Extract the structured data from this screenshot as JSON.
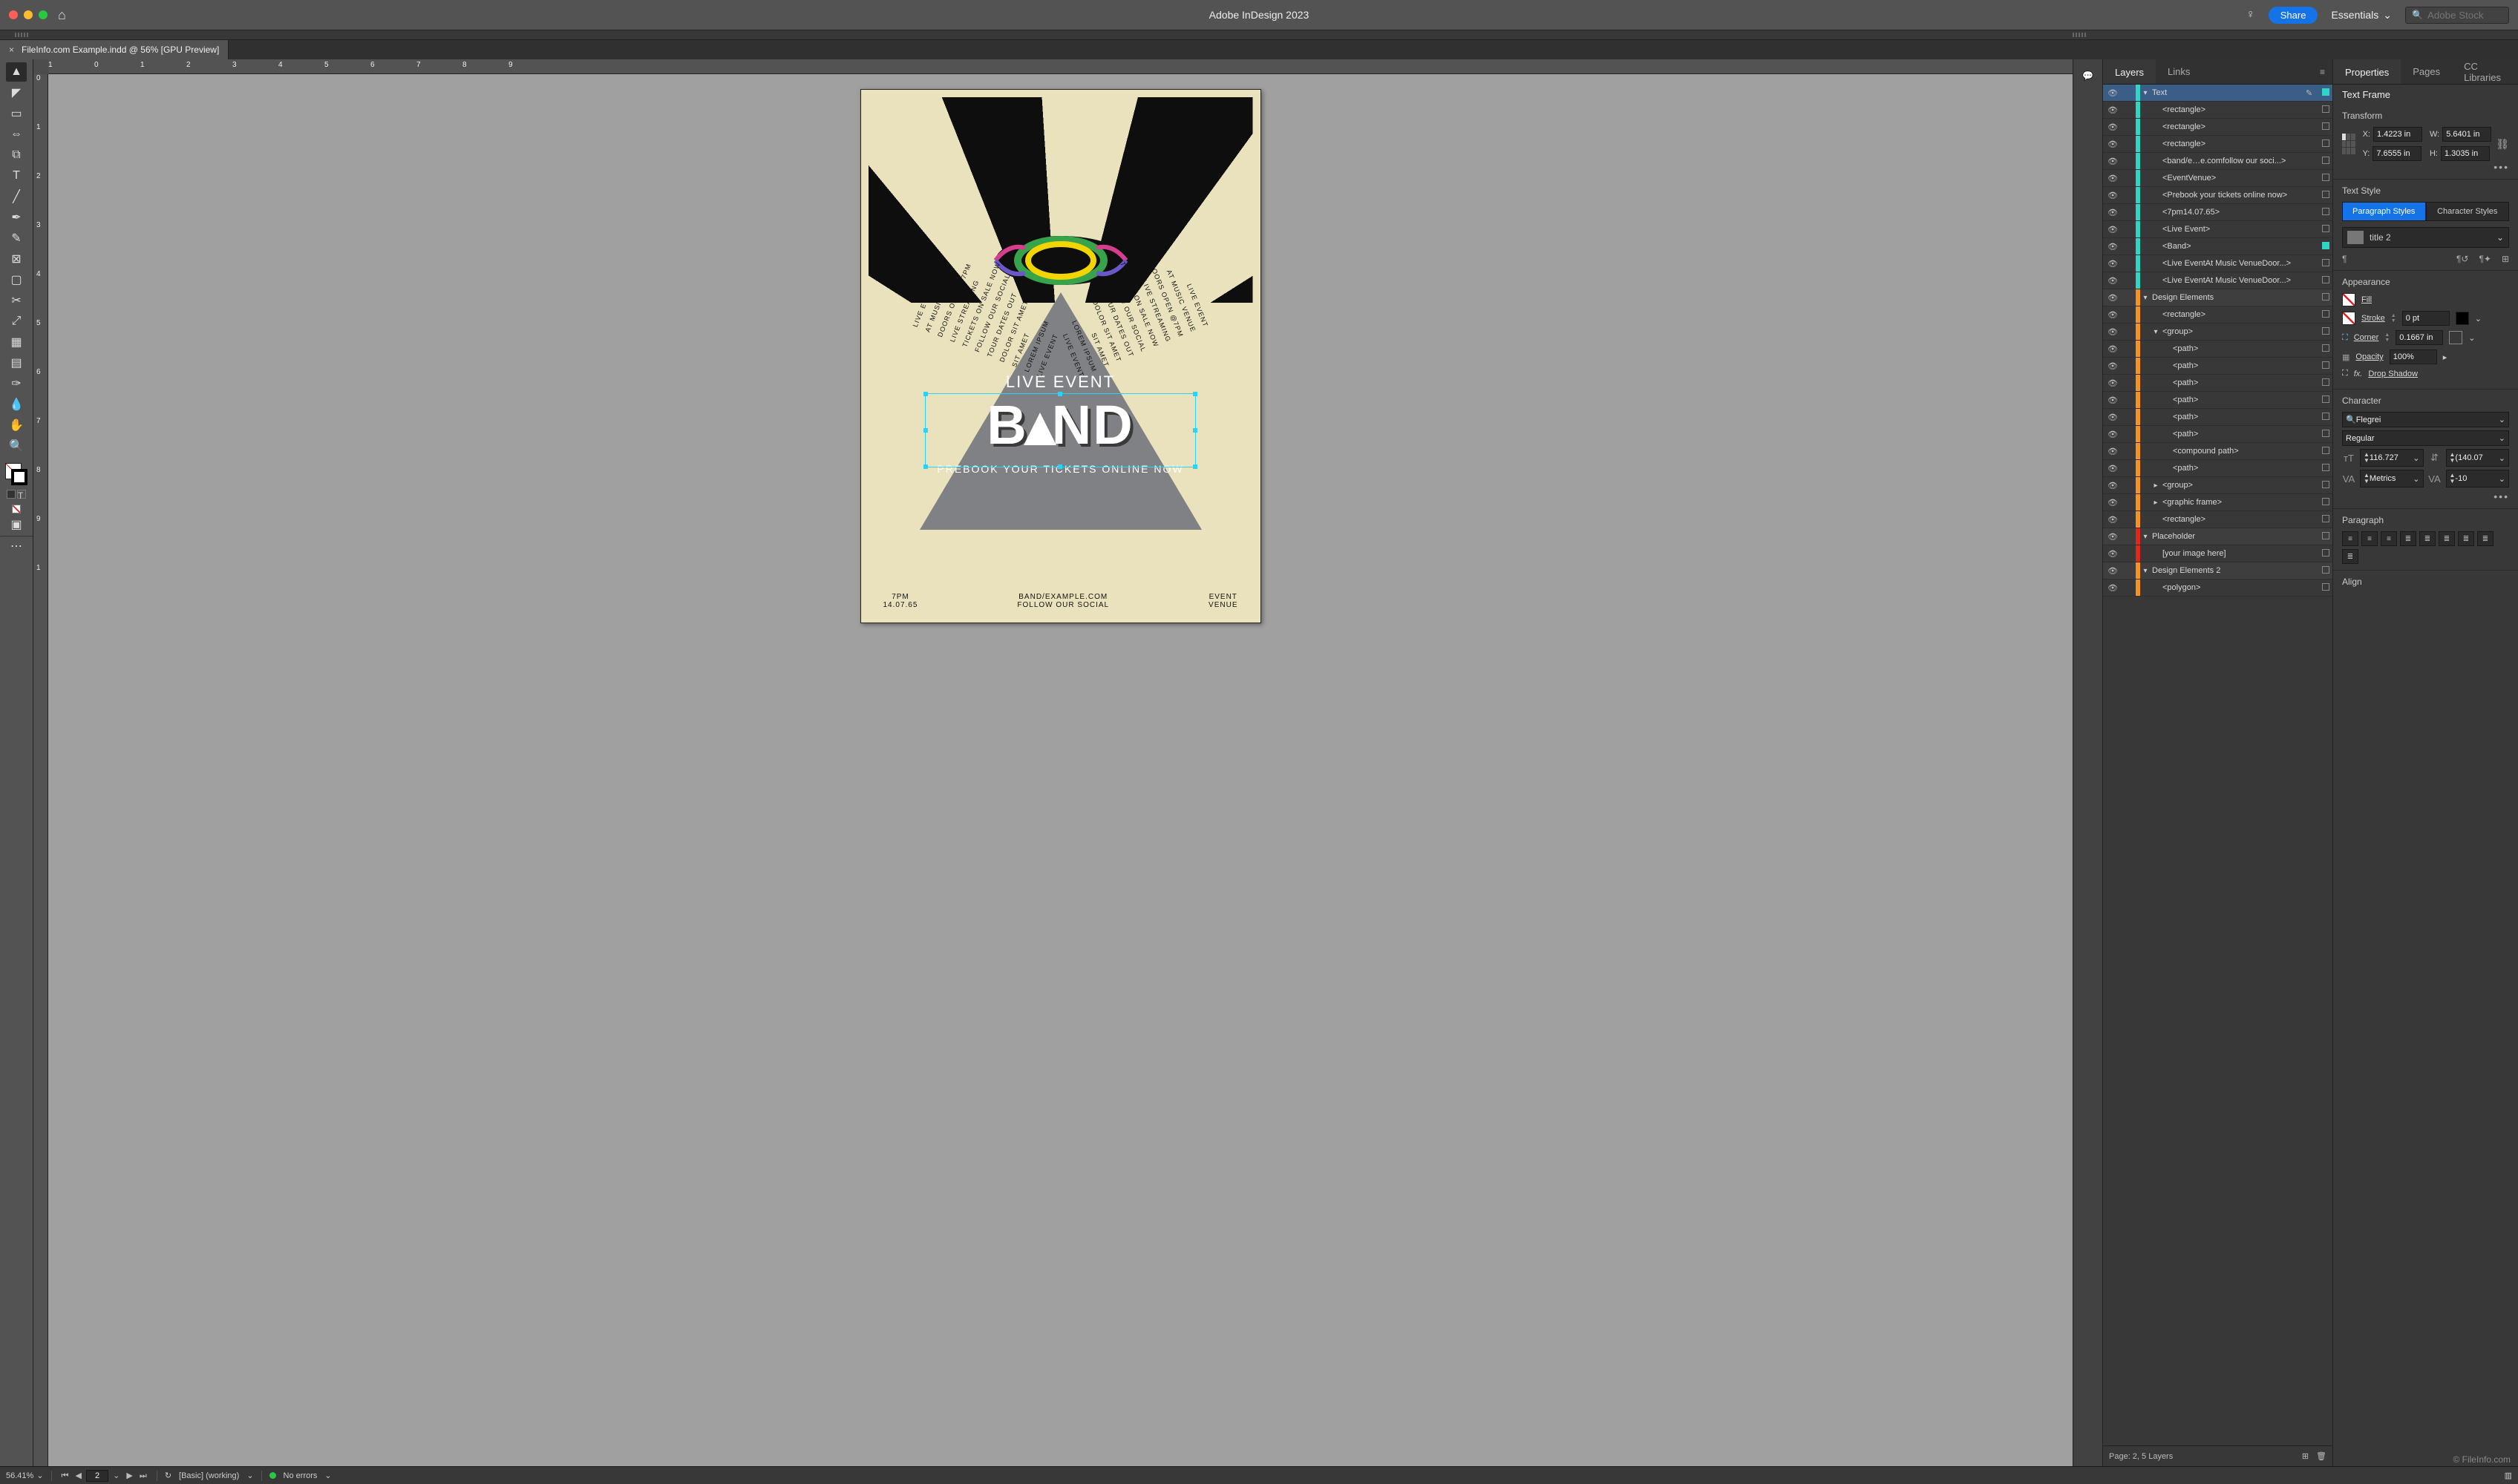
{
  "app_title": "Adobe InDesign 2023",
  "titlebar": {
    "share_label": "Share",
    "workspace_label": "Essentials",
    "search_placeholder": "Adobe Stock"
  },
  "document_tab": "FileInfo.com Example.indd @ 56% [GPU Preview]",
  "ruler_h": [
    "1",
    "0",
    "1",
    "2",
    "3",
    "4",
    "5",
    "6",
    "7",
    "8",
    "9"
  ],
  "ruler_v": [
    "0",
    "1",
    "2",
    "3",
    "4",
    "5",
    "6",
    "7",
    "8",
    "9",
    "1"
  ],
  "poster": {
    "live_event": "LIVE EVENT",
    "band": "BAND",
    "prebook": "PREBOOK YOUR TICKETS ONLINE NOW",
    "side_lines": [
      "LIVE EVENT",
      "AT MUSIC VENUE",
      "DOORS OPEN @7PM",
      "LIVE STREAMING",
      "TICKETS ON SALE NOW",
      "FOLLOW OUR SOCIAL",
      "TOUR DATES OUT",
      "DOLOR SIT AMET",
      "SIT AMET",
      "LOREM IPSUM",
      "LIVE EVENT"
    ],
    "footer_left_1": "7PM",
    "footer_left_2": "14.07.65",
    "footer_center_1": "BAND/EXAMPLE.COM",
    "footer_center_2": "FOLLOW OUR SOCIAL",
    "footer_right_1": "EVENT",
    "footer_right_2": "VENUE"
  },
  "panels": {
    "layers_tab": "Layers",
    "links_tab": "Links",
    "properties_tab": "Properties",
    "pages_tab": "Pages",
    "cclib_tab": "CC Libraries"
  },
  "layers": [
    {
      "d": 0,
      "c": "teal",
      "disc": "down",
      "name": "Text",
      "pen": true,
      "sel": true,
      "selbox": "on",
      "group": true
    },
    {
      "d": 1,
      "c": "teal",
      "name": "<rectangle>"
    },
    {
      "d": 1,
      "c": "teal",
      "name": "<rectangle>"
    },
    {
      "d": 1,
      "c": "teal",
      "name": "<rectangle>"
    },
    {
      "d": 1,
      "c": "teal",
      "name": "<band/e…e.comfollow our soci...>"
    },
    {
      "d": 1,
      "c": "teal",
      "name": "<EventVenue>"
    },
    {
      "d": 1,
      "c": "teal",
      "name": "<Prebook your tickets online now>"
    },
    {
      "d": 1,
      "c": "teal",
      "name": "<7pm14.07.65>"
    },
    {
      "d": 1,
      "c": "teal",
      "name": "<Live Event>"
    },
    {
      "d": 1,
      "c": "teal",
      "name": "<Band>",
      "selbox": "on"
    },
    {
      "d": 1,
      "c": "teal",
      "name": "<Live EventAt Music VenueDoor...>"
    },
    {
      "d": 1,
      "c": "teal",
      "name": "<Live EventAt Music VenueDoor...>"
    },
    {
      "d": 0,
      "c": "orange",
      "disc": "down",
      "name": "Design Elements",
      "group": true
    },
    {
      "d": 1,
      "c": "orange",
      "name": "<rectangle>"
    },
    {
      "d": 1,
      "c": "orange",
      "disc": "down",
      "name": "<group>"
    },
    {
      "d": 2,
      "c": "orange",
      "name": "<path>"
    },
    {
      "d": 2,
      "c": "orange",
      "name": "<path>"
    },
    {
      "d": 2,
      "c": "orange",
      "name": "<path>"
    },
    {
      "d": 2,
      "c": "orange",
      "name": "<path>"
    },
    {
      "d": 2,
      "c": "orange",
      "name": "<path>"
    },
    {
      "d": 2,
      "c": "orange",
      "name": "<path>"
    },
    {
      "d": 2,
      "c": "orange",
      "name": "<compound path>"
    },
    {
      "d": 2,
      "c": "orange",
      "name": "<path>"
    },
    {
      "d": 1,
      "c": "orange",
      "disc": "right",
      "name": "<group>"
    },
    {
      "d": 1,
      "c": "orange",
      "disc": "right",
      "name": "<graphic frame>"
    },
    {
      "d": 1,
      "c": "orange",
      "name": "<rectangle>"
    },
    {
      "d": 0,
      "c": "red",
      "disc": "down",
      "name": "Placeholder",
      "group": true
    },
    {
      "d": 1,
      "c": "red",
      "name": "[your image here]"
    },
    {
      "d": 0,
      "c": "orange",
      "disc": "down",
      "name": "Design Elements 2",
      "group": true
    },
    {
      "d": 1,
      "c": "orange",
      "name": "<polygon>"
    }
  ],
  "layers_footer": "Page: 2, 5 Layers",
  "props": {
    "frame_type": "Text Frame",
    "transform_h": "Transform",
    "x": "1.4223 in",
    "y": "7.6555 in",
    "w": "5.6401 in",
    "h": "1.3035 in",
    "text_style_h": "Text Style",
    "para_btn": "Paragraph Styles",
    "char_btn": "Character Styles",
    "style_name": "title 2",
    "appearance_h": "Appearance",
    "fill_label": "Fill",
    "stroke_label": "Stroke",
    "stroke_val": "0 pt",
    "corner_label": "Corner",
    "corner_val": "0.1667 in",
    "opacity_label": "Opacity",
    "opacity_val": "100%",
    "dropshadow": "Drop Shadow",
    "character_h": "Character",
    "font_family": "Flegrei",
    "font_style": "Regular",
    "font_size": "116.727",
    "leading": "(140.07",
    "kerning": "Metrics",
    "tracking": "-10",
    "paragraph_h": "Paragraph",
    "align_h": "Align"
  },
  "status": {
    "zoom": "56.41%",
    "page": "2",
    "master": "[Basic] (working)",
    "errors": "No errors"
  },
  "watermark": "© FileInfo.com"
}
